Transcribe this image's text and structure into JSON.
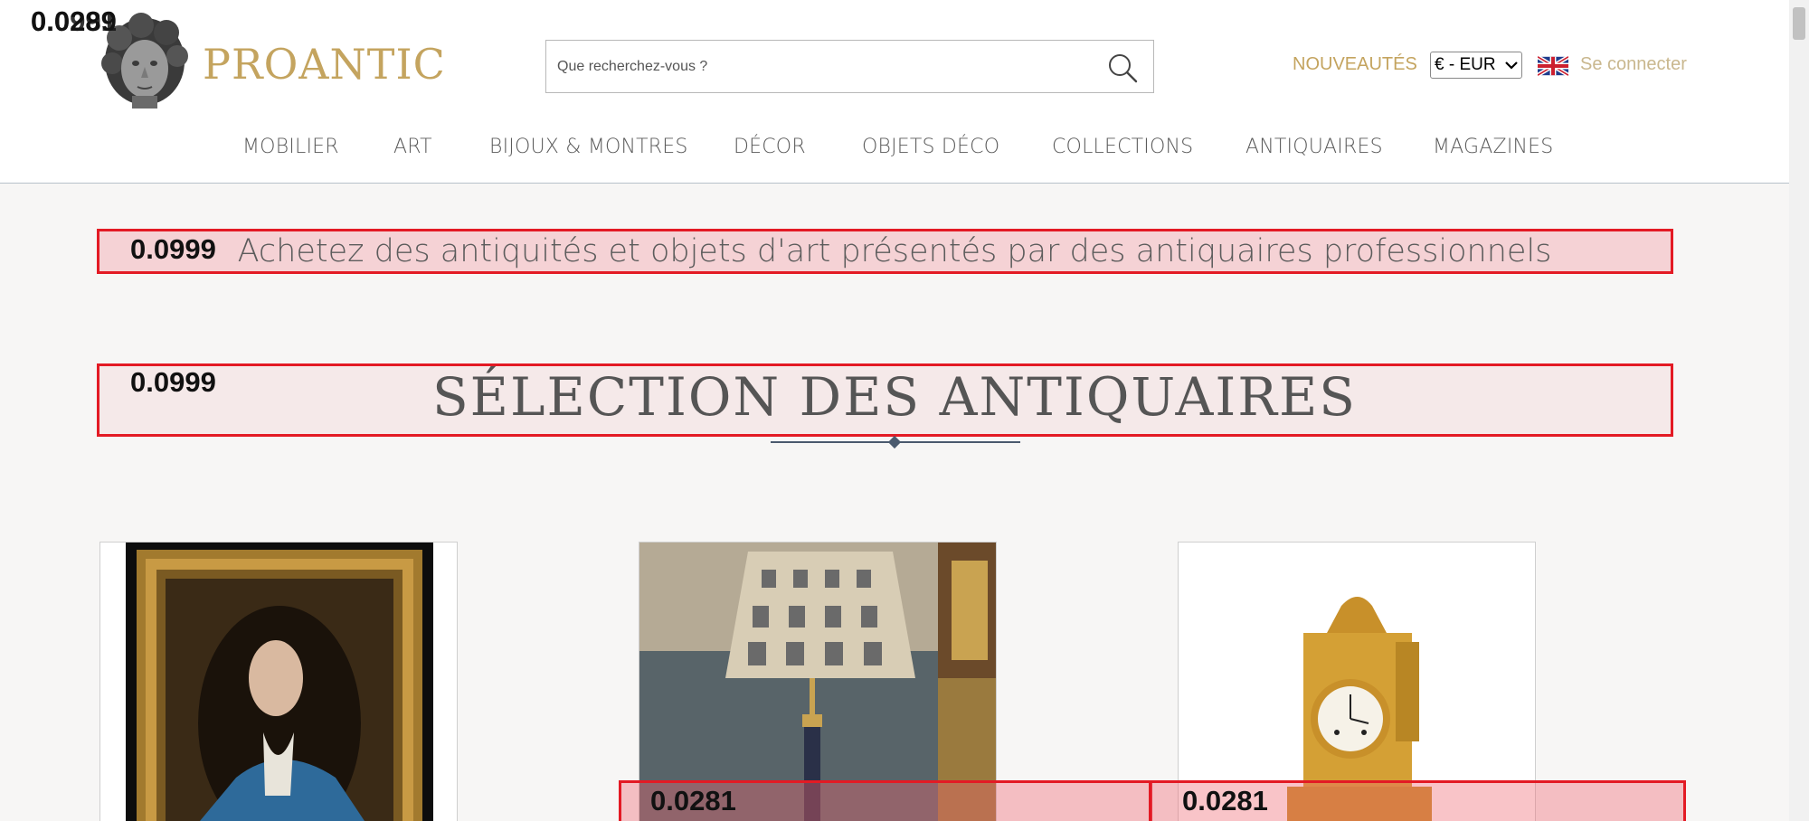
{
  "header": {
    "logo_text": "PROANTIC",
    "search": {
      "placeholder": "Que recherchez-vous ?"
    },
    "nouveautes_label": "NOUVEAUTÉS",
    "currency_selected": "€ - EUR",
    "login_label": "Se connecter"
  },
  "nav": {
    "items": [
      {
        "label": "MOBILIER"
      },
      {
        "label": "ART"
      },
      {
        "label": "BIJOUX & MONTRES"
      },
      {
        "label": "DÉCOR"
      },
      {
        "label": "OBJETS DÉCO"
      },
      {
        "label": "COLLECTIONS"
      },
      {
        "label": "ANTIQUAIRES"
      },
      {
        "label": "MAGAZINES"
      }
    ]
  },
  "main": {
    "tagline": "Achetez des antiquités et objets d'art présentés par des antiquaires professionnels",
    "section_title": "SÉLECTION DES ANTIQUAIRES"
  },
  "overlay_scores": {
    "top_left_a": "0.0289",
    "top_left_b": "0.0991",
    "tagline_score": "0.0999",
    "section_score": "0.0999",
    "card2_score": "0.0281",
    "card3_score": "0.0281"
  },
  "colors": {
    "gold": "#c4a45f",
    "highlight_border": "#e31a24",
    "nav_divider": "#4a5a6e"
  }
}
